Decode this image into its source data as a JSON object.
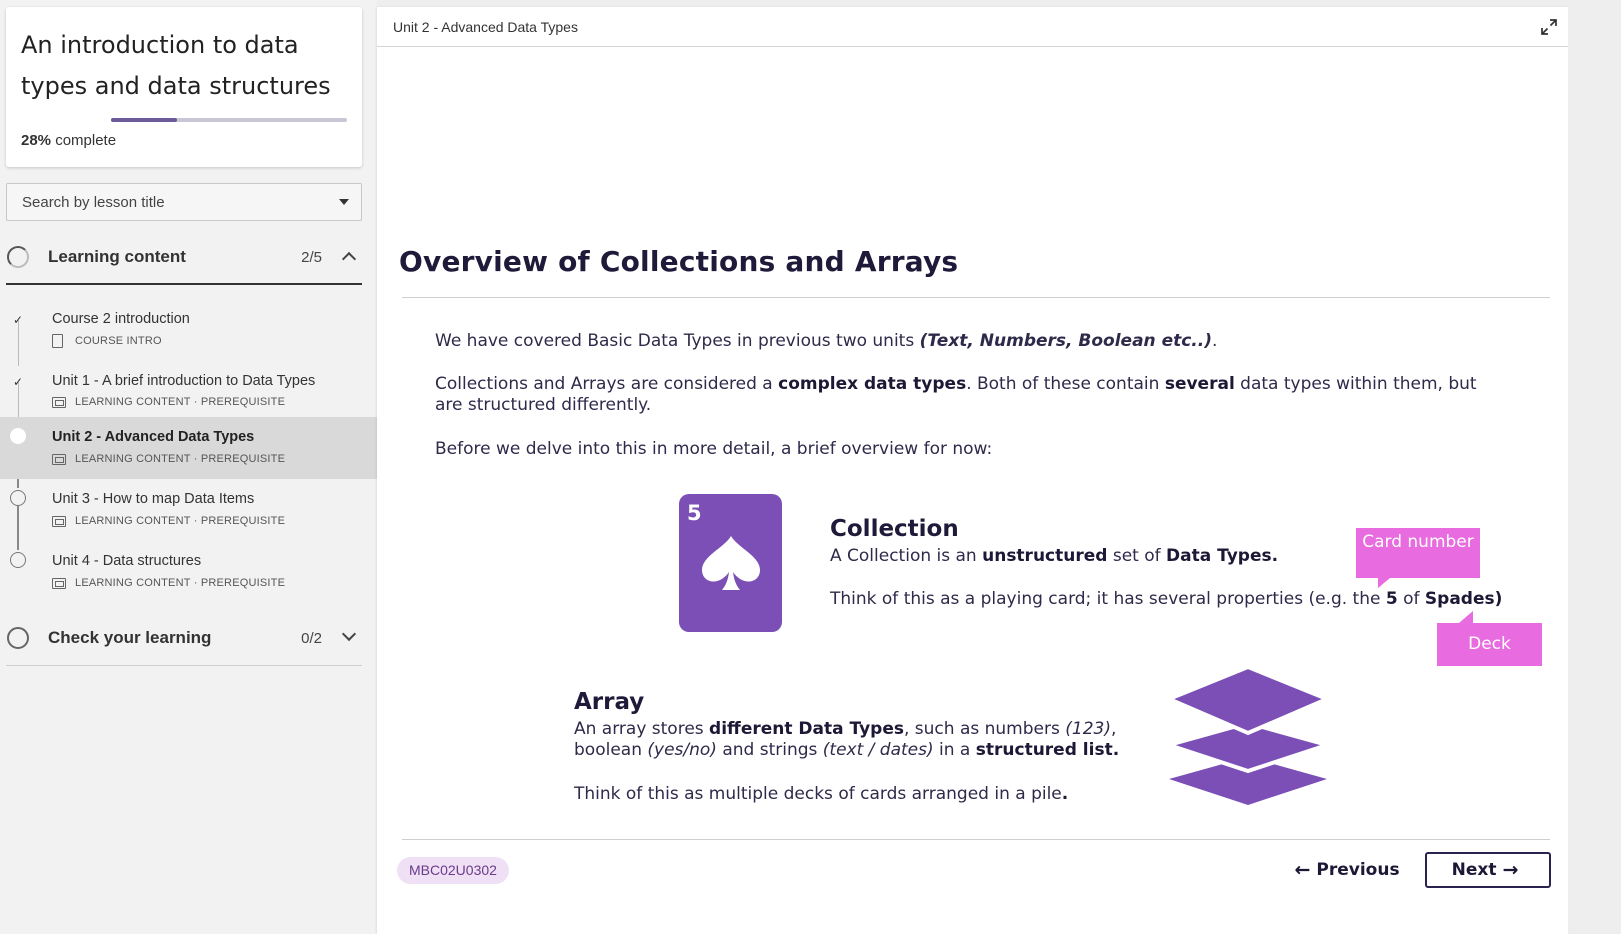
{
  "course": {
    "title": "An introduction to data types and data structures",
    "progress_percent": "28%",
    "progress_fraction": 0.28,
    "progress_suffix": "complete"
  },
  "search": {
    "placeholder": "Search by lesson title"
  },
  "sections": [
    {
      "label": "Learning content",
      "count": "2/5",
      "expanded": true
    },
    {
      "label": "Check your learning",
      "count": "0/2",
      "expanded": false
    }
  ],
  "lessons": [
    {
      "title": "Course 2 introduction",
      "meta": "COURSE INTRO",
      "icon": "document-icon",
      "status": "complete"
    },
    {
      "title": "Unit 1 - A brief introduction to Data Types",
      "meta": "LEARNING CONTENT · PREREQUISITE",
      "icon": "slides-icon",
      "status": "complete"
    },
    {
      "title": "Unit 2 - Advanced Data Types",
      "meta": "LEARNING CONTENT · PREREQUISITE",
      "icon": "slides-icon",
      "status": "current"
    },
    {
      "title": "Unit 3 - How to map Data Items",
      "meta": "LEARNING CONTENT · PREREQUISITE",
      "icon": "slides-icon",
      "status": "incomplete"
    },
    {
      "title": "Unit 4 - Data structures",
      "meta": "LEARNING CONTENT · PREREQUISITE",
      "icon": "slides-icon",
      "status": "incomplete"
    }
  ],
  "topbar": {
    "breadcrumb": "Unit 2 - Advanced Data Types"
  },
  "content": {
    "heading": "Overview of Collections and Arrays",
    "p1_a": "We have covered Basic Data Types in previous two units ",
    "p1_i": "(Text, Numbers, Boolean etc..)",
    "p1_b": ".",
    "p2_a": "Collections and Arrays are considered a ",
    "p2_b1": "complex data types",
    "p2_c": ". Both of these contain ",
    "p2_b2": "several",
    "p2_d": " data types within them, but are structured differently.",
    "p3": "Before we delve into this in more detail, a brief overview for now:",
    "card_number": "5",
    "collection": {
      "heading": "Collection",
      "line1_a": "A Collection is an ",
      "line1_b1": "unstructured",
      "line1_c": " set of ",
      "line1_b2": "Data Types.",
      "line2_a": "Think of this as a playing card; it has several properties (e.g. the ",
      "line2_b1": "5",
      "line2_c": " of ",
      "line2_b2": "Spades)"
    },
    "callouts": {
      "card_number": "Card number",
      "deck": "Deck"
    },
    "array": {
      "heading": "Array",
      "line1_a": "An array stores ",
      "line1_b1": "different Data Types",
      "line1_c": ", such as numbers ",
      "line1_i1": "(123)",
      "line1_d": ", boolean ",
      "line1_i2": "(yes/no)",
      "line1_e": " and strings ",
      "line1_i3": "(text / dates)",
      "line1_f": " in a ",
      "line1_b2": "structured list.",
      "line2_a": " Think of this as multiple decks of cards arranged in a pile",
      "line2_b": "."
    }
  },
  "footer": {
    "code": "MBC02U0302",
    "previous_label": "Previous",
    "next_label": "Next"
  },
  "colors": {
    "accent_purple": "#7b4fb6",
    "callout_pink": "#e86bdf",
    "heading_navy": "#1f1a3a"
  }
}
